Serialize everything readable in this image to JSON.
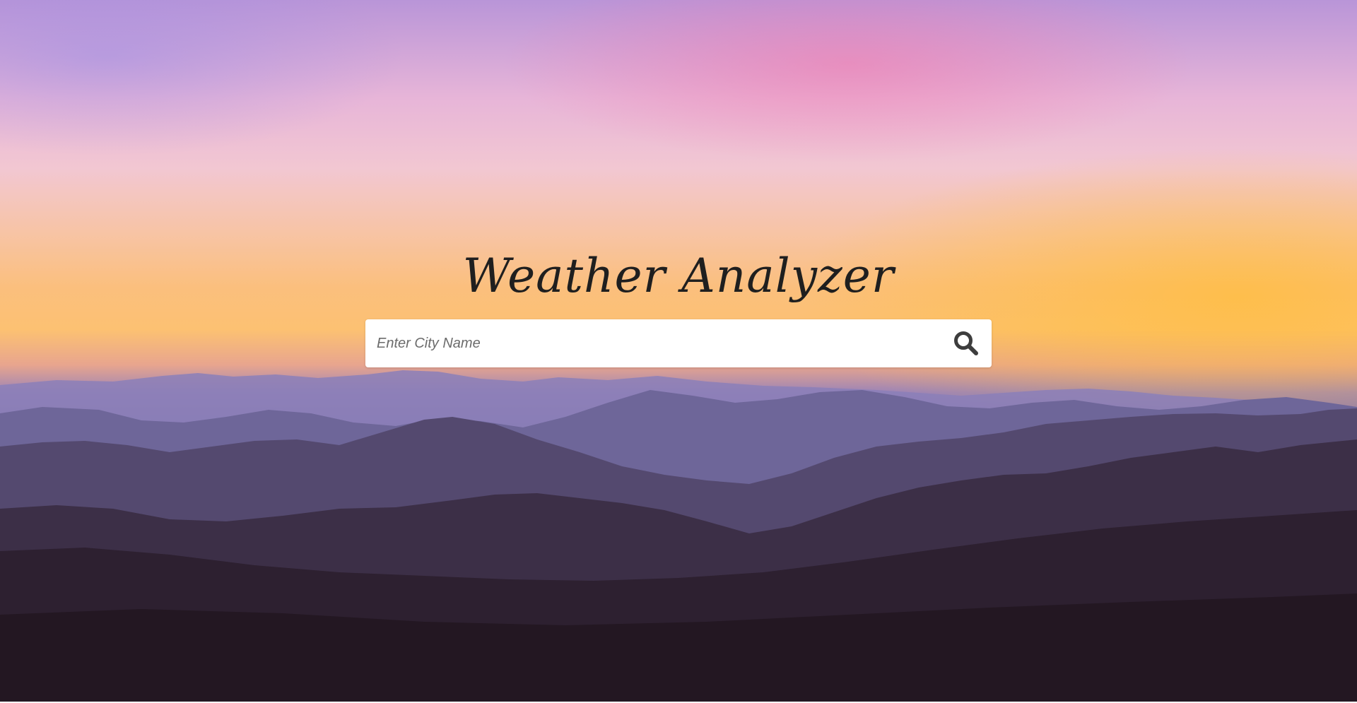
{
  "app": {
    "title": "Weather Analyzer"
  },
  "search": {
    "placeholder": "Enter City Name",
    "value": "",
    "button_icon": "search-icon"
  },
  "colors": {
    "title_text": "#1f1f1f",
    "search_icon": "#3d3d3d",
    "search_background": "#ffffff"
  }
}
